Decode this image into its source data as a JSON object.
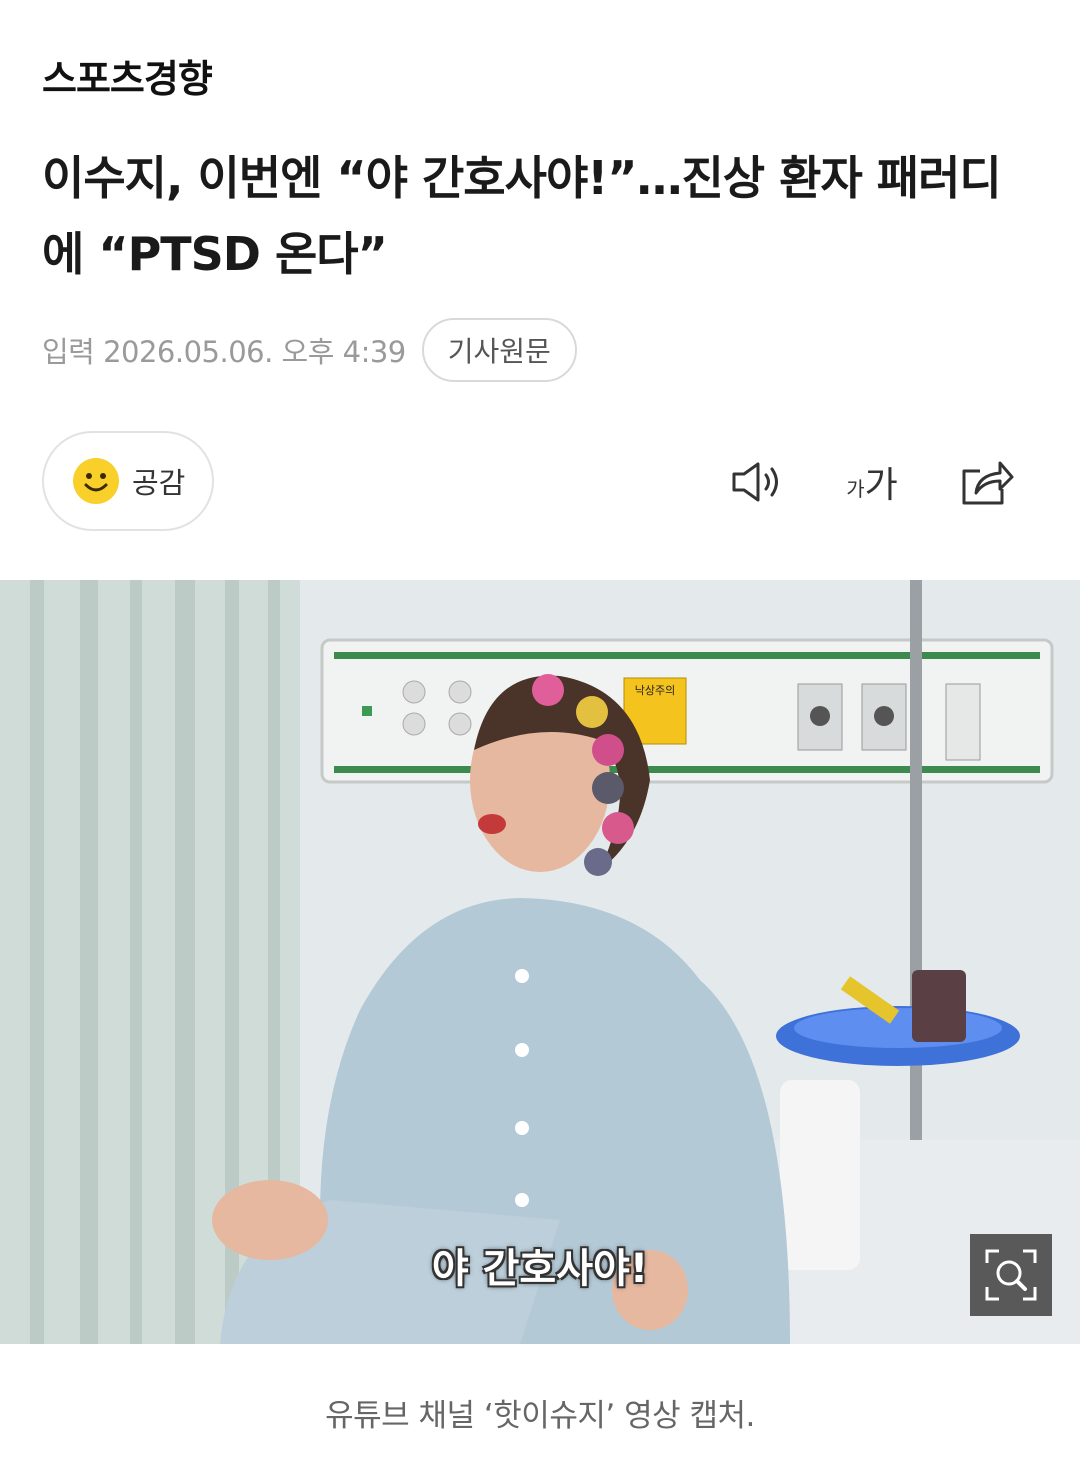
{
  "header": {
    "logo_text": "스포츠경향"
  },
  "article": {
    "headline": "이수지, 이번엔 “야 간호사야!”…진상 환자 패러디에 “PTSD 온다”",
    "published": "입력 2026.05.06. 오후 4:39",
    "source_button": "기사원문"
  },
  "toolbar": {
    "reaction_label": "공감",
    "font_small": "가",
    "font_big": "가",
    "icons": [
      "smiley-icon",
      "speaker-icon",
      "font-size-icon",
      "share-icon"
    ]
  },
  "media": {
    "subtitle": "야 간호사야!",
    "caption": "유튜브 채널 ‘핫이슈지’ 영상 캡처.",
    "sign_text": "낙상주의",
    "icons": [
      "zoom-icon"
    ]
  },
  "colors": {
    "accent_yellow": "#f9cf2a",
    "text": "#1a1a1a",
    "muted": "#9a9a9a"
  }
}
